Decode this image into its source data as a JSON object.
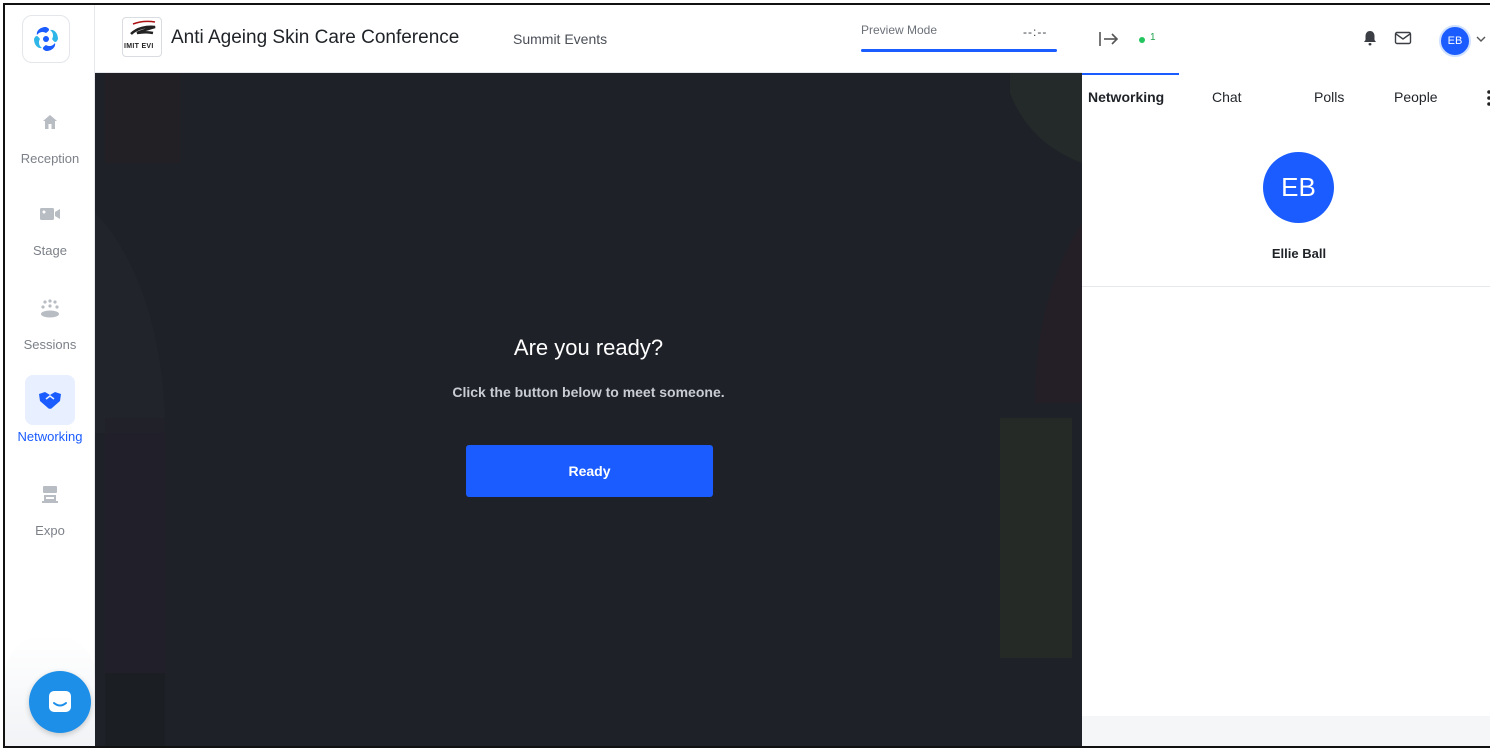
{
  "sidebar": {
    "items": [
      {
        "label": "Reception",
        "icon": "home-icon"
      },
      {
        "label": "Stage",
        "icon": "video-camera-icon"
      },
      {
        "label": "Sessions",
        "icon": "audience-icon"
      },
      {
        "label": "Networking",
        "icon": "handshake-icon",
        "active": true
      },
      {
        "label": "Expo",
        "icon": "booth-icon"
      }
    ],
    "launcher_icon": "chat-bubble-icon"
  },
  "header": {
    "logo_text": "IMIT EVI",
    "title": "Anti Ageing Skin Care Conference",
    "organizer": "Summit Events",
    "preview_label": "Preview Mode",
    "timer": "--:--",
    "preview_progress_pct": 100
  },
  "stage": {
    "heading": "Are you ready?",
    "subtext": "Click the button below to meet someone.",
    "button_label": "Ready"
  },
  "right_panel": {
    "online_count": "1",
    "user_initials": "EB",
    "tabs": [
      {
        "label": "Networking",
        "active": true
      },
      {
        "label": "Chat"
      },
      {
        "label": "Polls"
      },
      {
        "label": "People"
      }
    ],
    "profile": {
      "initials": "EB",
      "name": "Ellie Ball"
    }
  },
  "colors": {
    "accent": "#1a5cff",
    "stage_bg": "#1e2128",
    "online": "#22c55e",
    "launcher": "#1e8fe8"
  }
}
